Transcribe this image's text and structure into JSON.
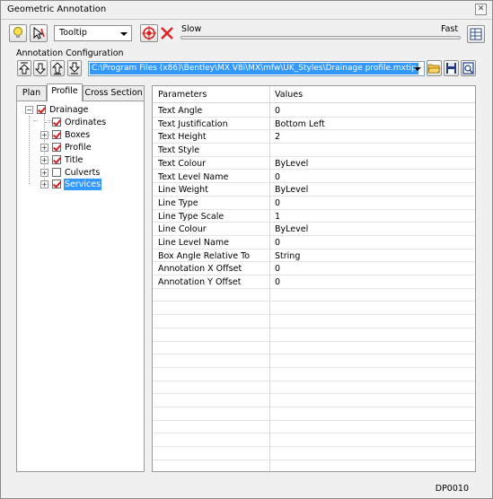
{
  "window": {
    "title": "Geometric Annotation"
  },
  "toolbar": {
    "display_mode": "Tooltip",
    "slow_label": "Slow",
    "fast_label": "Fast"
  },
  "config": {
    "section_label": "Annotation Configuration",
    "path": "C:\\Program Files (x86)\\Bentley\\MX V8i\\MX\\mfw\\UK_Styles\\Drainage profile.mxtip"
  },
  "tabs": [
    {
      "label": "Plan"
    },
    {
      "label": "Profile"
    },
    {
      "label": "Cross Section"
    }
  ],
  "tree": {
    "root": "Drainage",
    "children": [
      "Ordinates",
      "Boxes",
      "Profile",
      "Title",
      "Culverts",
      "Services"
    ]
  },
  "grid": {
    "headers": [
      "Parameters",
      "Values"
    ],
    "rows": [
      {
        "p": "Text Angle",
        "v": "0"
      },
      {
        "p": "Text Justification",
        "v": "Bottom Left"
      },
      {
        "p": "Text Height",
        "v": "2"
      },
      {
        "p": "Text Style",
        "v": ""
      },
      {
        "p": "Text Colour",
        "v": "ByLevel"
      },
      {
        "p": "Text Level Name",
        "v": "0"
      },
      {
        "p": "Line Weight",
        "v": "ByLevel"
      },
      {
        "p": "Line Type",
        "v": "0"
      },
      {
        "p": "Line Type Scale",
        "v": "1"
      },
      {
        "p": "Line Colour",
        "v": "ByLevel"
      },
      {
        "p": "Line Level Name",
        "v": "0"
      },
      {
        "p": "Box Angle Relative To",
        "v": "String"
      },
      {
        "p": "Annotation X Offset",
        "v": "0"
      },
      {
        "p": "Annotation Y Offset",
        "v": "0"
      }
    ]
  },
  "status": {
    "code": "DP0010"
  },
  "colors": {
    "selection": "#3399ff",
    "check": "#d81e1e",
    "delete": "#e02020"
  }
}
